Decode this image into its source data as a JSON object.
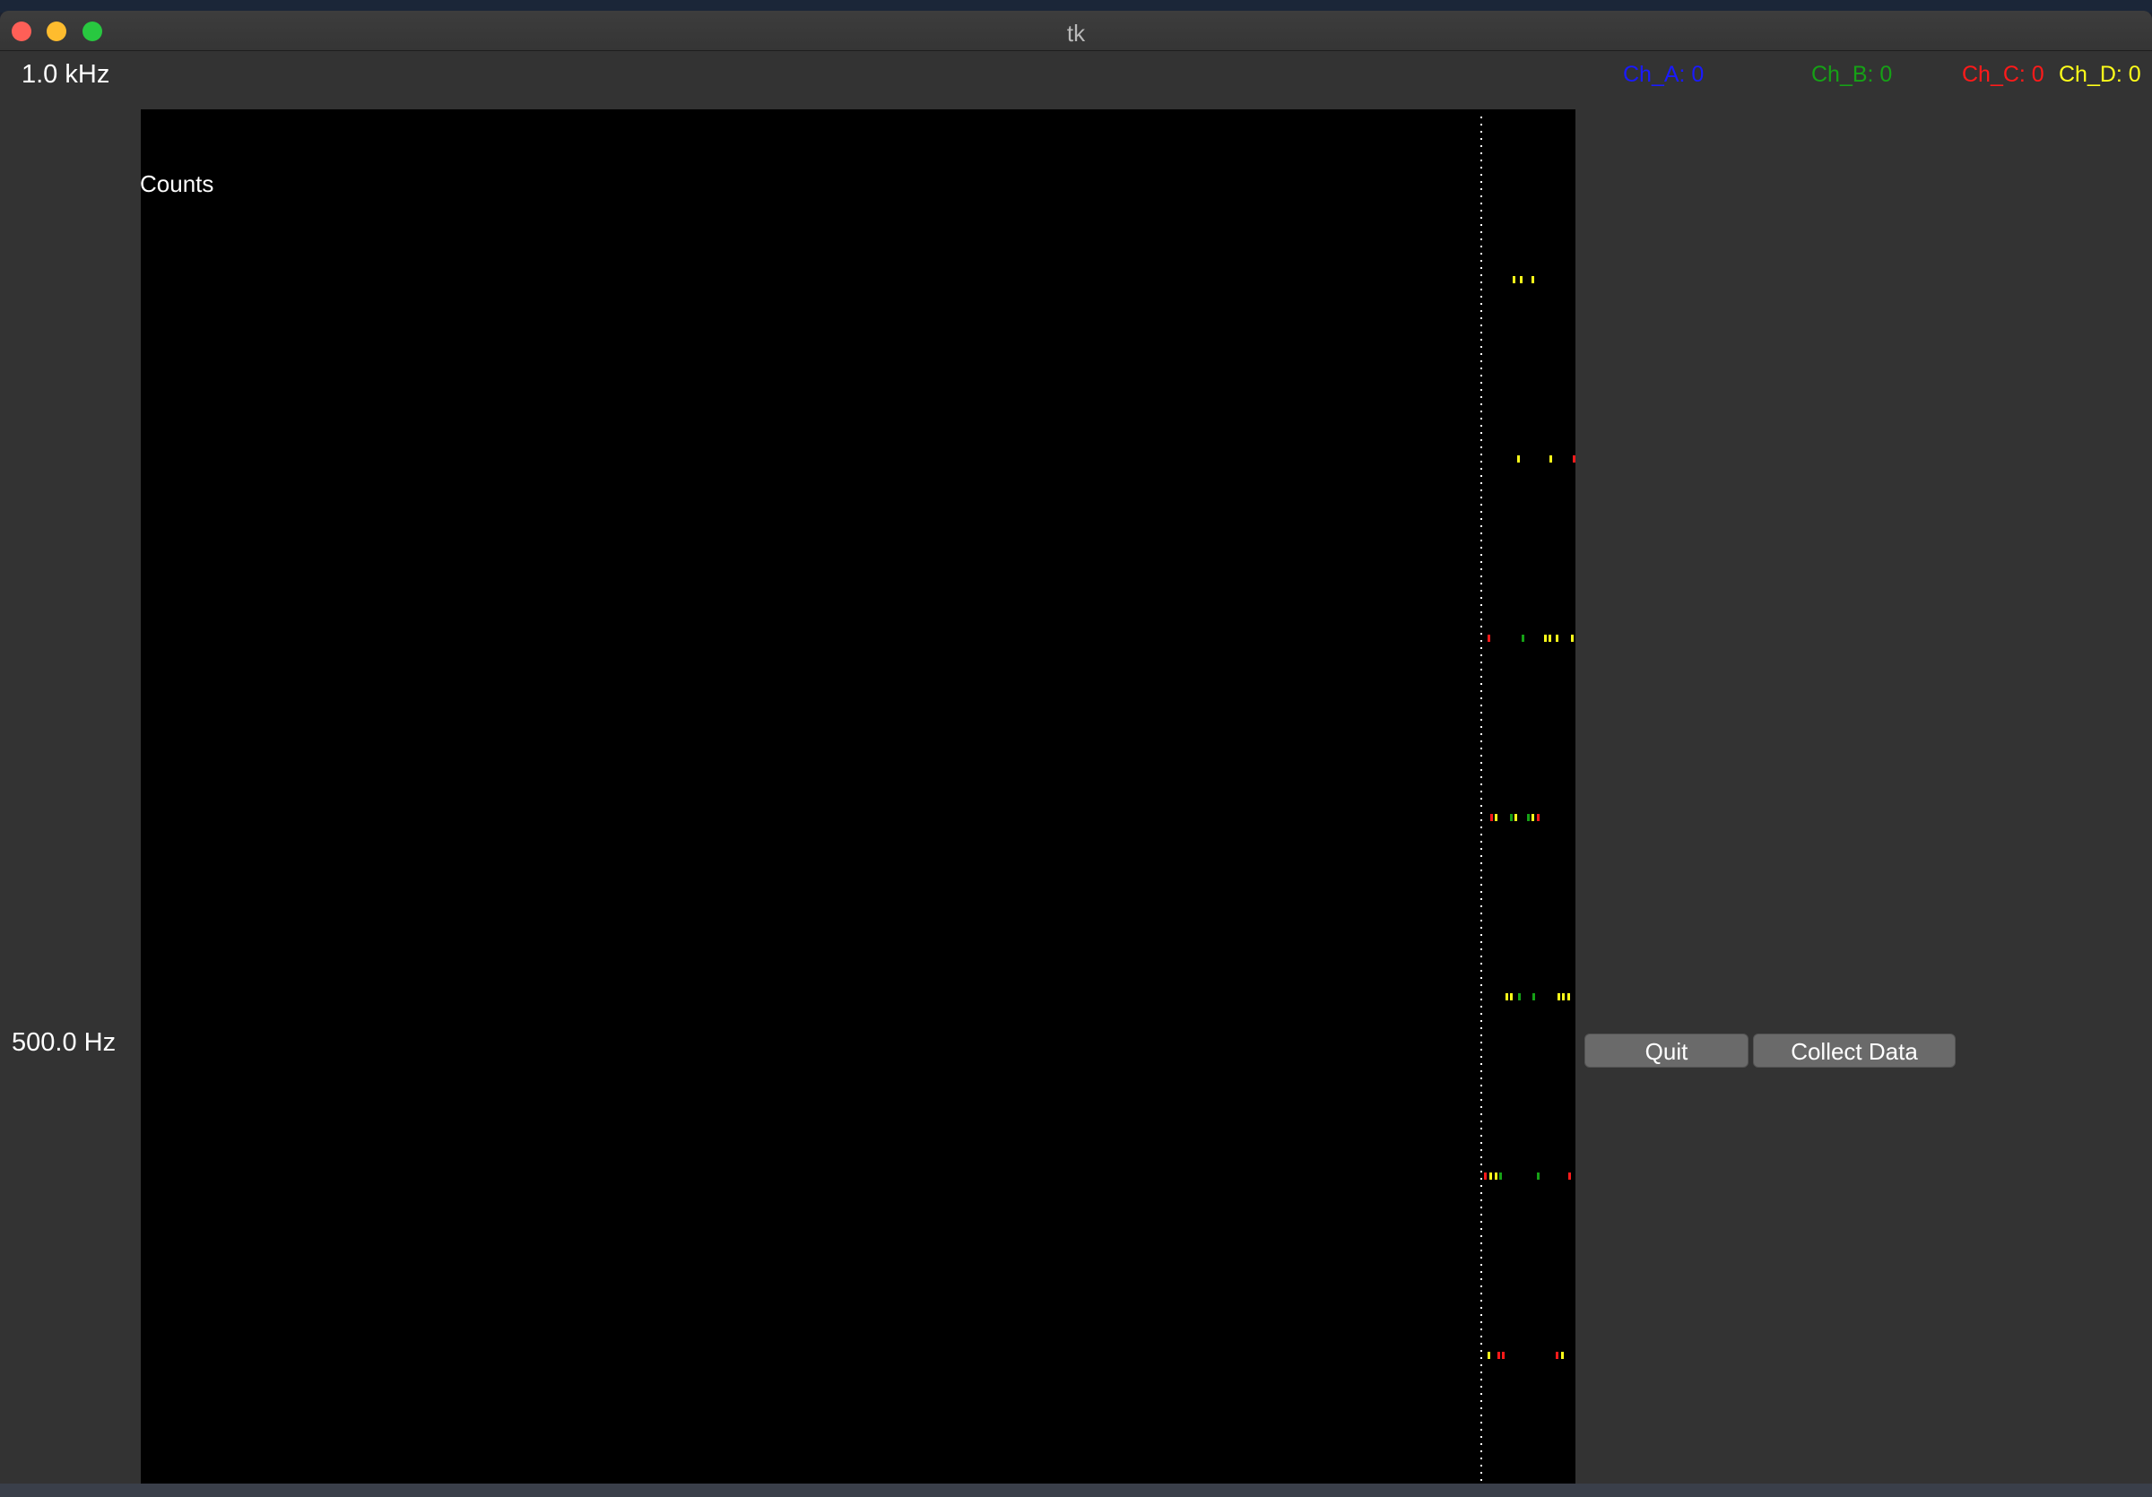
{
  "window": {
    "title": "tk"
  },
  "freq_axis": {
    "top_label": "1.0 kHz",
    "mid_label": "500.0 Hz"
  },
  "plot": {
    "counts_label": "Counts",
    "background": "#000000"
  },
  "channels": [
    {
      "label": "Ch_A: 0",
      "color": "#1a1aff"
    },
    {
      "label": "Ch_B: 0",
      "color": "#16a116"
    },
    {
      "label": "Ch_C: 0",
      "color": "#ff1a1a"
    },
    {
      "label": "Ch_D: 0",
      "color": "#ffff1a"
    }
  ],
  "buttons": {
    "quit_label": "Quit",
    "collect_label": "Collect Data"
  }
}
